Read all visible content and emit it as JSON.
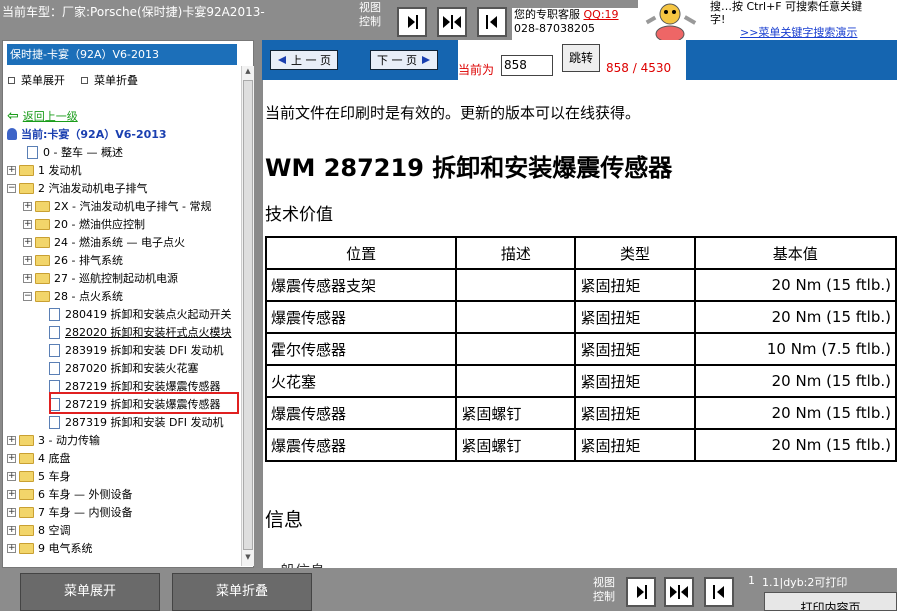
{
  "topbar": {
    "car_title": "当前车型：厂家:Porsche(保时捷)卡宴92A2013-",
    "view_label": "视图控制",
    "service_text": "您的专职客服",
    "service_qq": "QQ:19",
    "service_phone": "028-87038205",
    "hint_line1": "搜…按 Ctrl+F 可搜索任意关键",
    "hint_line2": "字!",
    "hint_link": ">>菜单关键字搜索演示"
  },
  "sidebar": {
    "model_header": "保时捷-卡宴（92A）V6-2013",
    "expand_label": "菜单展开",
    "collapse_label": "菜单折叠"
  },
  "tree": [
    {
      "id": "back",
      "label": "返回上一级",
      "type": "back"
    },
    {
      "id": "current",
      "label": "当前:卡宴（92A）V6-2013",
      "type": "current"
    },
    {
      "id": "n0",
      "label": "0 - 整车 — 概述",
      "type": "doc"
    },
    {
      "id": "n1",
      "label": "1 发动机",
      "type": "folder",
      "state": "+"
    },
    {
      "id": "n2",
      "label": "2 汽油发动机电子排气",
      "type": "folder",
      "state": "-"
    },
    {
      "id": "n2x",
      "label": "2X - 汽油发动机电子排气 - 常规",
      "type": "folder",
      "state": "+"
    },
    {
      "id": "n20",
      "label": "20 - 燃油供应控制",
      "type": "folder",
      "state": "+"
    },
    {
      "id": "n24",
      "label": "24 - 燃油系统 — 电子点火",
      "type": "folder",
      "state": "+"
    },
    {
      "id": "n26",
      "label": "26 - 排气系统",
      "type": "folder",
      "state": "+"
    },
    {
      "id": "n27",
      "label": "27 - 巡航控制起动机电源",
      "type": "folder",
      "state": "+"
    },
    {
      "id": "n28",
      "label": "28 - 点火系统",
      "type": "folder",
      "state": "-"
    },
    {
      "id": "d1",
      "label": "280419 拆卸和安装点火起动开关",
      "type": "doc"
    },
    {
      "id": "d2",
      "label": "282020 拆卸和安装杆式点火模块",
      "type": "doc"
    },
    {
      "id": "d3",
      "label": "283919 拆卸和安装 DFI 发动机",
      "type": "doc"
    },
    {
      "id": "d4",
      "label": "287020 拆卸和安装火花塞",
      "type": "doc"
    },
    {
      "id": "d5",
      "label": "287219 拆卸和安装爆震传感器",
      "type": "doc"
    },
    {
      "id": "d6",
      "label": "287219 拆卸和安装爆震传感器",
      "type": "doc",
      "selected": true
    },
    {
      "id": "d7",
      "label": "287319 拆卸和安装 DFI 发动机",
      "type": "doc"
    },
    {
      "id": "n3",
      "label": "3 - 动力传输",
      "type": "folder",
      "state": "+"
    },
    {
      "id": "n4",
      "label": "4 底盘",
      "type": "folder",
      "state": "+"
    },
    {
      "id": "n5",
      "label": "5 车身",
      "type": "folder",
      "state": "+"
    },
    {
      "id": "n6",
      "label": "6 车身 — 外侧设备",
      "type": "folder",
      "state": "+"
    },
    {
      "id": "n7",
      "label": "7 车身 — 内侧设备",
      "type": "folder",
      "state": "+"
    },
    {
      "id": "n8",
      "label": "8 空调",
      "type": "folder",
      "state": "+"
    },
    {
      "id": "n9",
      "label": "9 电气系统",
      "type": "folder",
      "state": "+"
    }
  ],
  "nav": {
    "prev_label": "上 一 页",
    "next_label": "下 一 页",
    "current_label": "当前为",
    "page_value": "858",
    "jump_label": "跳转",
    "page_count": "858 / 4530"
  },
  "content": {
    "notice": "当前文件在印刷时是有效的。更新的版本可以在线获得。",
    "title": "WM 287219 拆卸和安装爆震传感器",
    "tech_heading": "技术价值",
    "table_headers": [
      "位置",
      "描述",
      "类型",
      "基本值"
    ],
    "table_rows": [
      [
        "爆震传感器支架",
        "",
        "紧固扭矩",
        "20 Nm (15 ftlb.)"
      ],
      [
        "爆震传感器",
        "",
        "紧固扭矩",
        "20 Nm (15 ftlb.)"
      ],
      [
        "霍尔传感器",
        "",
        "紧固扭矩",
        "10 Nm (7.5 ftlb.)"
      ],
      [
        "火花塞",
        "",
        "紧固扭矩",
        "20 Nm (15 ftlb.)"
      ],
      [
        "爆震传感器",
        "紧固螺钉",
        "紧固扭矩",
        "20 Nm (15 ftlb.)"
      ],
      [
        "爆震传感器",
        "紧固螺钉",
        "紧固扭矩",
        "20 Nm (15 ftlb.)"
      ]
    ],
    "info_heading": "信息",
    "cut_text": "一般信息"
  },
  "bottombar": {
    "expand_label": "菜单展开",
    "collapse_label": "菜单折叠",
    "view_label": "视图控制",
    "page_num": "1",
    "print_info": "1.1|dyb:2可打印",
    "print_label": "打印内容页"
  },
  "colors": {
    "accent_blue": "#1565b0",
    "header_blue": "#1c6fb9",
    "selection_red": "#e02020",
    "bar_gray": "#8c8c8c"
  }
}
